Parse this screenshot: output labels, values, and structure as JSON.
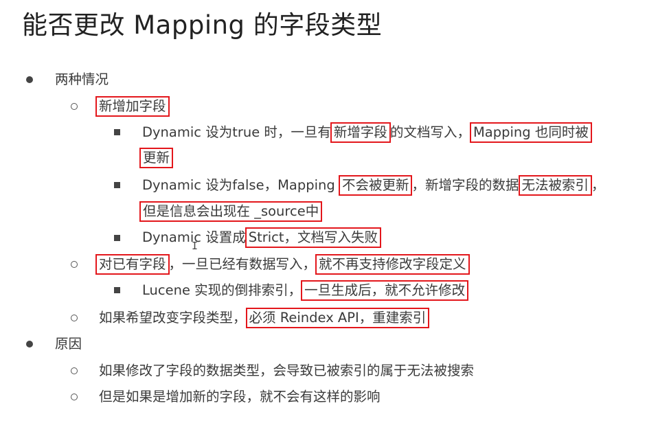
{
  "title": "能否更改 Mapping 的字段类型",
  "l1_a": "两种情况",
  "l2_a": "新增加字段",
  "l3_a": {
    "p1": "Dynamic 设为true 时，一旦有",
    "h1": "新增字段",
    "p2": "的文档写入，",
    "h2": "Mapping 也同时被",
    "h3": "更新"
  },
  "l3_b": {
    "p1": "Dynamic 设为false，Mapping ",
    "h1": "不会被更新",
    "p2": "，新增字段的数据",
    "h2": "无法被索引",
    "p3": "，",
    "h3": "但是信息会出现在 _source中"
  },
  "l3_c": {
    "p1": "Dynamic 设置成",
    "h1": "Strict，文档写入失败"
  },
  "l2_b": {
    "h1": "对已有字段",
    "p1": "，一旦已经有数据写入，",
    "h2": "就不再支持修改字段定义"
  },
  "l3_d": {
    "p1": "Lucene 实现的倒排索引，",
    "h1": "一旦生成后，就不允许修改"
  },
  "l2_c": {
    "p1": "如果希望改变字段类型，",
    "h1": "必须 Reindex API，重建索引"
  },
  "l1_b": "原因",
  "l2_d": "如果修改了字段的数据类型，会导致已被索引的属于无法被搜索",
  "l2_e": "但是如果是增加新的字段，就不会有这样的影响",
  "cursor_glyph": "I",
  "colors": {
    "highlight_box": "#e3161b",
    "text": "#3a3a3a"
  }
}
